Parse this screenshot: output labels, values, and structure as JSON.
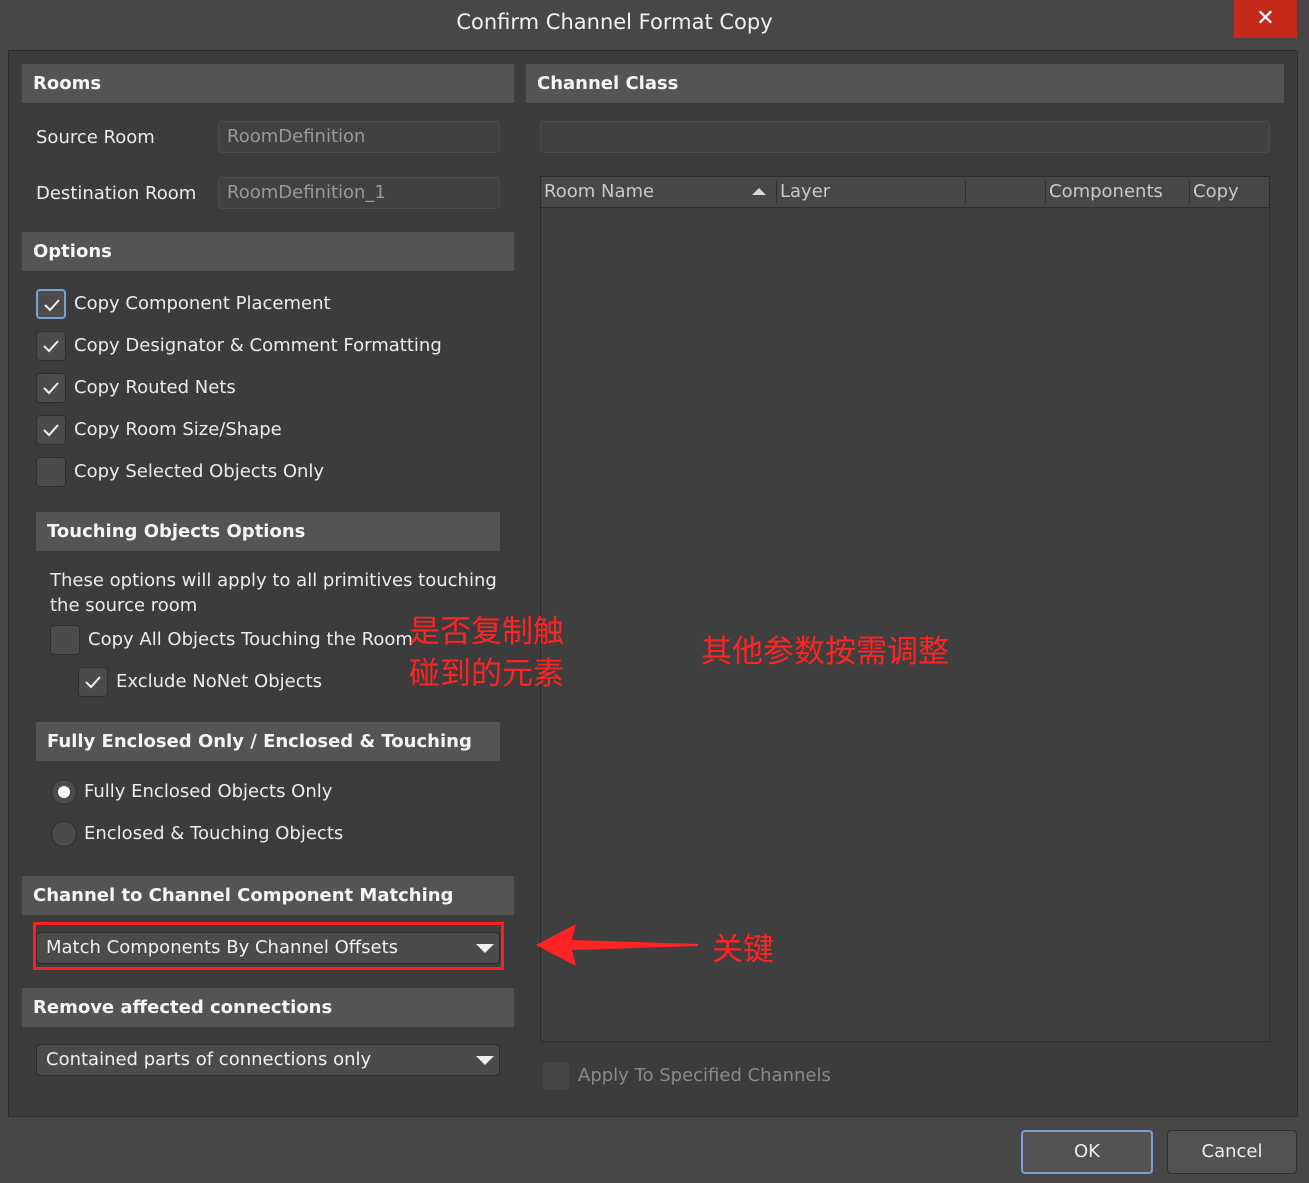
{
  "window": {
    "title": "Confirm Channel Format Copy"
  },
  "rooms": {
    "heading": "Rooms",
    "source_label": "Source Room",
    "source_value": "RoomDefinition",
    "dest_label": "Destination Room",
    "dest_value": "RoomDefinition_1"
  },
  "options": {
    "heading": "Options",
    "items": [
      {
        "label": "Copy Component Placement",
        "checked": true
      },
      {
        "label": "Copy Designator & Comment Formatting",
        "checked": true
      },
      {
        "label": "Copy Routed Nets",
        "checked": true
      },
      {
        "label": "Copy Room Size/Shape",
        "checked": true
      },
      {
        "label": "Copy Selected Objects Only",
        "checked": false
      }
    ]
  },
  "touching": {
    "heading": "Touching Objects Options",
    "desc_line1": "These options will apply to all primitives touching",
    "desc_line2": "the source room",
    "copy_all_label": "Copy All Objects Touching the Room",
    "copy_all_checked": false,
    "exclude_label": "Exclude NoNet Objects",
    "exclude_checked": true
  },
  "enclosure": {
    "heading": "Fully Enclosed Only / Enclosed & Touching",
    "option1": "Fully Enclosed Objects Only",
    "option2": "Enclosed & Touching Objects",
    "selected": "Fully Enclosed Objects Only"
  },
  "matching": {
    "heading": "Channel to Channel Component Matching",
    "selected": "Match Components By Channel Offsets"
  },
  "remove": {
    "heading": "Remove affected connections",
    "selected": "Contained parts of connections only"
  },
  "channel_class": {
    "heading": "Channel Class",
    "field_value": "",
    "columns": [
      "Room Name",
      "Layer",
      "",
      "Components",
      "Copy"
    ],
    "sort_column": "Room Name",
    "apply_label": "Apply To Specified Channels",
    "apply_checked": false
  },
  "buttons": {
    "ok": "OK",
    "cancel": "Cancel"
  },
  "annotations": {
    "touch_line1": "是否复制触",
    "touch_line2": "碰到的元素",
    "other": "其他参数按需调整",
    "key": "关键",
    "color": "#ff2424"
  },
  "colors": {
    "accent_focus": "#7aa0d6",
    "close_red": "#c42b1c"
  }
}
